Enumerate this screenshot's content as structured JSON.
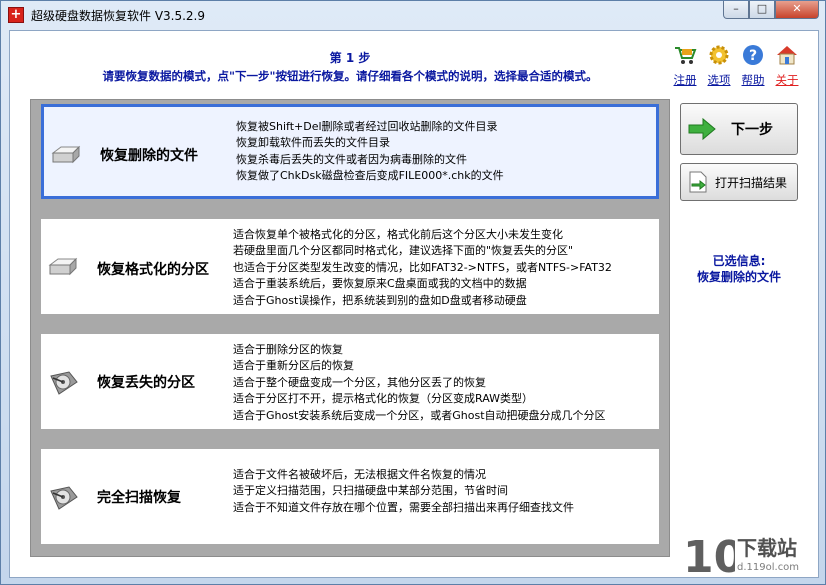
{
  "window": {
    "title": "超级硬盘数据恢复软件 V3.5.2.9",
    "controls": {
      "minimize": "–",
      "maximize": "□",
      "close": "✕"
    }
  },
  "header": {
    "step": "第 1 步",
    "instruction": "请要恢复数据的模式，点\"下一步\"按钮进行恢复。请仔细看各个模式的说明，选择最合适的模式。"
  },
  "toplinks": [
    {
      "label": "注册",
      "icon": "cart-icon"
    },
    {
      "label": "选项",
      "icon": "gear-icon"
    },
    {
      "label": "帮助",
      "icon": "help-icon"
    },
    {
      "label": "关于",
      "icon": "home-icon"
    }
  ],
  "modes": [
    {
      "name": "恢复删除的文件",
      "icon": "hard-disk-icon",
      "selected": true,
      "desc": [
        "恢复被Shift+Del删除或者经过回收站删除的文件目录",
        "恢复卸载软件而丢失的文件目录",
        "恢复杀毒后丢失的文件或者因为病毒删除的文件",
        "恢复做了ChkDsk磁盘检查后变成FILE000*.chk的文件"
      ]
    },
    {
      "name": "恢复格式化的分区",
      "icon": "hard-disk-icon",
      "selected": false,
      "desc": [
        "适合恢复单个被格式化的分区，格式化前后这个分区大小未发生变化",
        "若硬盘里面几个分区都同时格式化，建议选择下面的\"恢复丢失的分区\"",
        "也适合于分区类型发生改变的情况，比如FAT32->NTFS，或者NTFS->FAT32",
        "适合于重装系统后，要恢复原来C盘桌面或我的文档中的数据",
        "适合于Ghost误操作，把系统装到别的盘如D盘或者移动硬盘"
      ]
    },
    {
      "name": "恢复丢失的分区",
      "icon": "disk-platter-icon",
      "selected": false,
      "desc": [
        "适合于删除分区的恢复",
        "适合于重新分区后的恢复",
        "适合于整个硬盘变成一个分区，其他分区丢了的恢复",
        "适合于分区打不开，提示格式化的恢复（分区变成RAW类型）",
        "适合于Ghost安装系统后变成一个分区，或者Ghost自动把硬盘分成几个分区"
      ]
    },
    {
      "name": "完全扫描恢复",
      "icon": "disk-platter-icon",
      "selected": false,
      "desc": [
        "适合于文件名被破坏后，无法根据文件名恢复的情况",
        "适于定义扫描范围，只扫描硬盘中某部分范围，节省时间",
        "适合于不知道文件存放在哪个位置，需要全部扫描出来再仔细查找文件"
      ]
    }
  ],
  "buttons": {
    "next": "下一步",
    "open_scan": "打开扫描结果"
  },
  "selection": {
    "heading": "已选信息:",
    "value": "恢复删除的文件"
  },
  "watermark": {
    "text": "下载站",
    "url": "d.119ol.com"
  },
  "colors": {
    "accent_text": "#0a18a0",
    "selection_border": "#3a6ed8",
    "about_link": "#e02020"
  }
}
